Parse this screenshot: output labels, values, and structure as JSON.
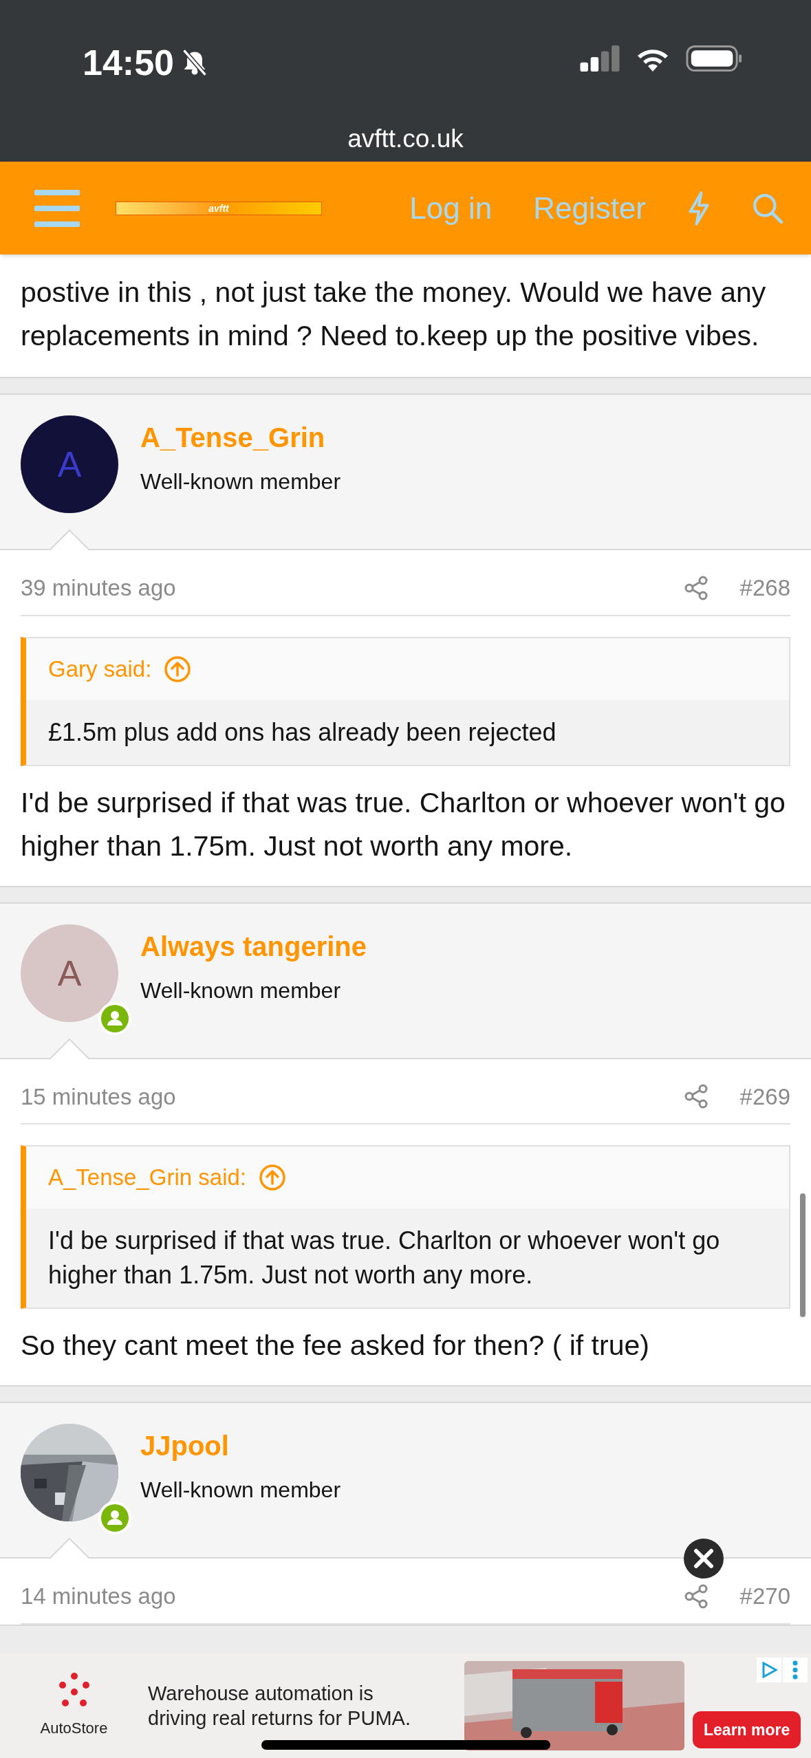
{
  "status_bar": {
    "time": "14:50",
    "silent": true
  },
  "address_bar": {
    "url": "avftt.co.uk"
  },
  "nav": {
    "logo_text": "avftt",
    "links": [
      "Log in",
      "Register"
    ]
  },
  "partial_post": {
    "text": "postive in this , not just take the money. Would we have any replacements in mind ? Need to.keep up the positive vibes."
  },
  "posts": [
    {
      "author": "A_Tense_Grin",
      "role": "Well-known member",
      "avatar": {
        "kind": "letter",
        "letter": "A",
        "color": "#11113a"
      },
      "online": false,
      "time": "39 minutes ago",
      "number": "#268",
      "quote": {
        "author": "Gary said:",
        "text": "£1.5m plus add ons has already been rejected"
      },
      "body": "I'd be surprised if that was true. Charlton or whoever won't go higher than 1.75m. Just not worth any more."
    },
    {
      "author": "Always tangerine",
      "role": "Well-known member",
      "avatar": {
        "kind": "letter",
        "letter": "A",
        "color": "#d8c6c6"
      },
      "online": true,
      "time": "15 minutes ago",
      "number": "#269",
      "quote": {
        "author": "A_Tense_Grin said:",
        "text": "I'd be surprised if that was true. Charlton or whoever won't go higher than 1.75m. Just not worth any more."
      },
      "body": "So they cant meet the fee asked for then? ( if true)"
    },
    {
      "author": "JJpool",
      "role": "Well-known member",
      "online": true,
      "time": "14 minutes ago",
      "number": "#270"
    }
  ],
  "ad": {
    "brand": "AutoStore",
    "headline": "Warehouse automation is driving real returns for PUMA.",
    "cta": "Learn more"
  }
}
